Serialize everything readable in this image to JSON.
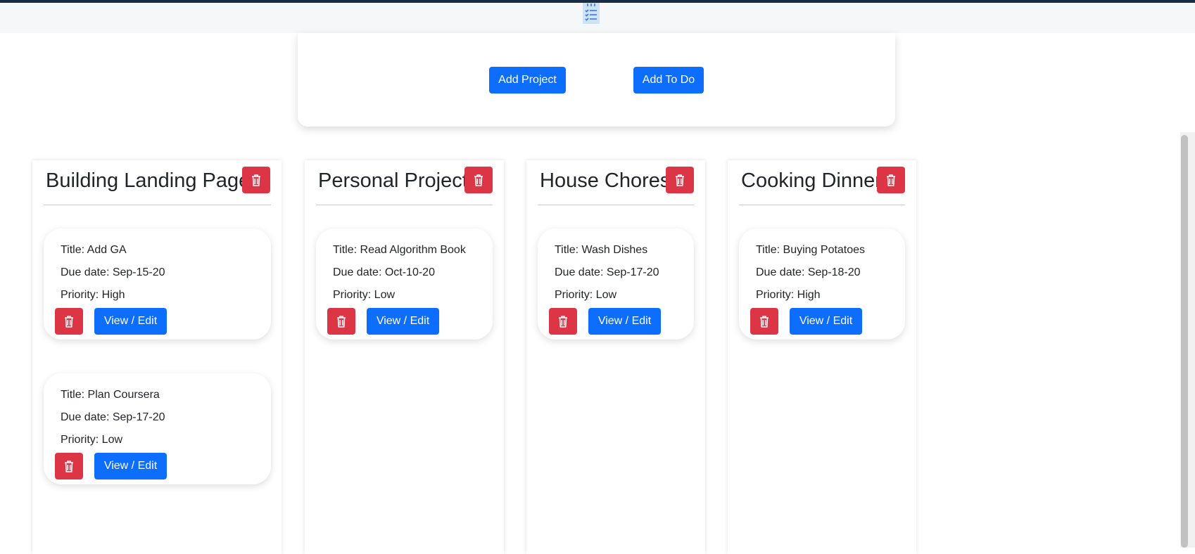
{
  "toolbar": {
    "add_project_label": "Add Project",
    "add_todo_label": "Add To Do"
  },
  "colors": {
    "primary": "#0d6efd",
    "danger": "#dc3545",
    "divider": "#a8d8dc",
    "header_border": "#1a2b45"
  },
  "icons": {
    "logo": "checklist-icon",
    "delete": "trash-icon"
  },
  "projects": [
    {
      "title": "Building Landing Page",
      "todos": [
        {
          "title": "Title: Add GA",
          "due": "Due date: Sep-15-20",
          "priority": "Priority: High",
          "edit_label": "View / Edit"
        },
        {
          "title": "Title: Plan Coursera",
          "due": "Due date: Sep-17-20",
          "priority": "Priority: Low",
          "edit_label": "View / Edit"
        }
      ]
    },
    {
      "title": "Personal Project",
      "todos": [
        {
          "title": "Title: Read Algorithm Book",
          "due": "Due date: Oct-10-20",
          "priority": "Priority: Low",
          "edit_label": "View / Edit"
        }
      ]
    },
    {
      "title": "House Chores",
      "todos": [
        {
          "title": "Title: Wash Dishes",
          "due": "Due date: Sep-17-20",
          "priority": "Priority: Low",
          "edit_label": "View / Edit"
        }
      ]
    },
    {
      "title": "Cooking Dinner",
      "todos": [
        {
          "title": "Title: Buying Potatoes",
          "due": "Due date: Sep-18-20",
          "priority": "Priority: High",
          "edit_label": "View / Edit"
        }
      ]
    }
  ]
}
